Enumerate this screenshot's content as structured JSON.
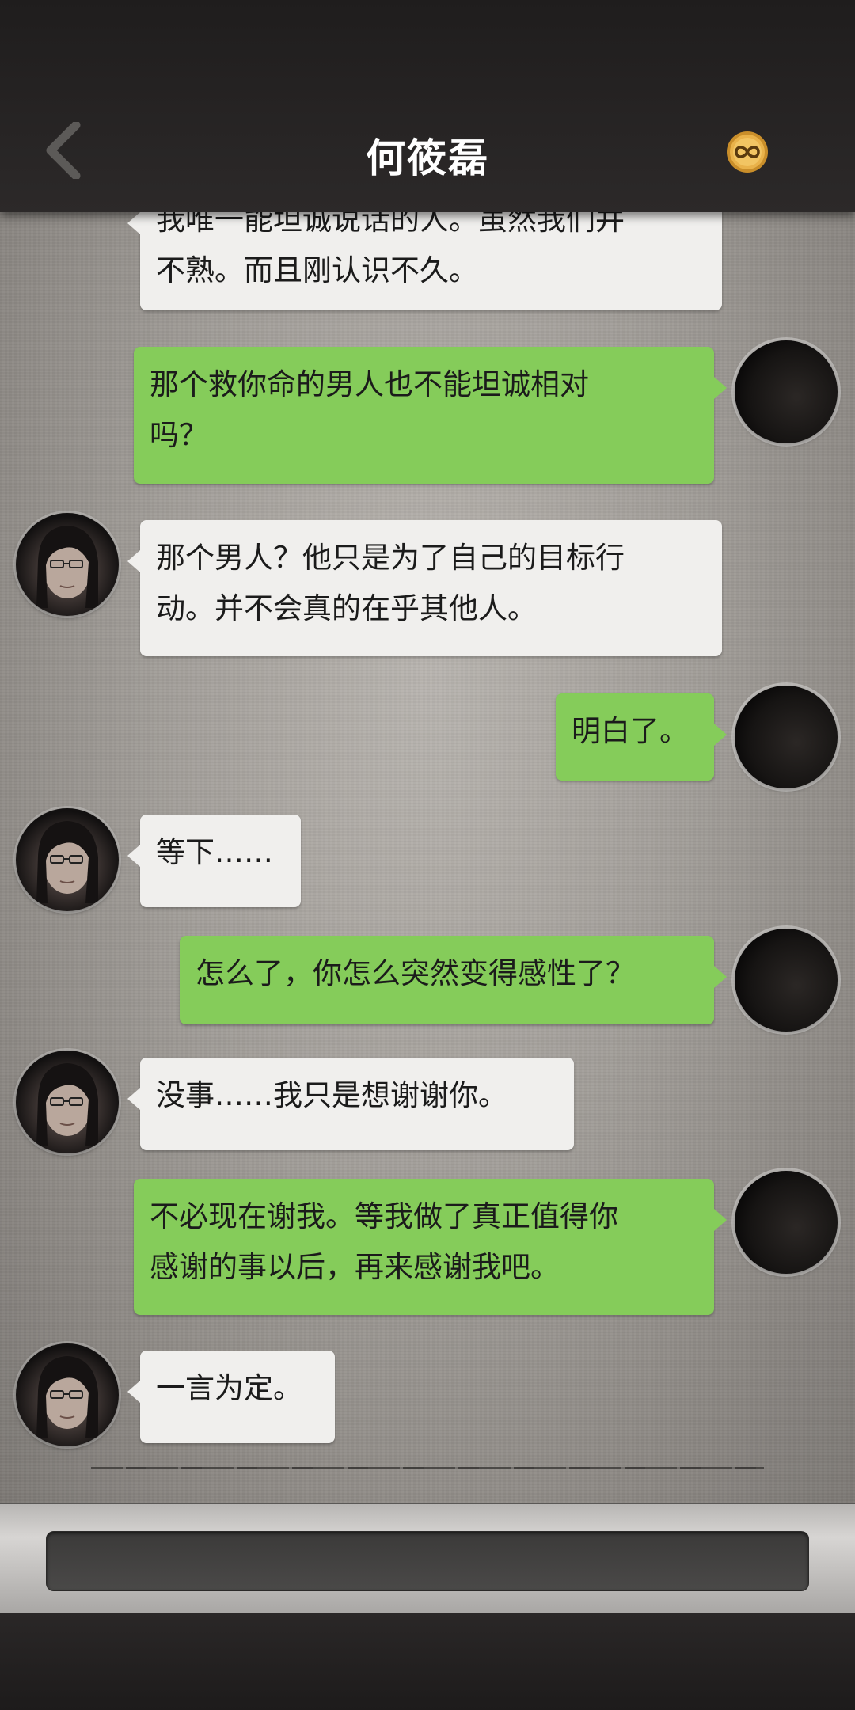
{
  "header": {
    "title": "何筱磊",
    "back_icon": "chevron-left-icon",
    "badge_icon": "infinity-coin-icon"
  },
  "messages": [
    {
      "side": "in",
      "text_line1": "我唯一能坦诚说话的人。虽然我们并",
      "text_line2": "不熟。而且刚认识不久。"
    },
    {
      "side": "out",
      "text_line1": "那个救你命的男人也不能坦诚相对",
      "text_line2": "吗？"
    },
    {
      "side": "in",
      "text_line1": "那个男人？他只是为了自己的目标行",
      "text_line2": "动。并不会真的在乎其他人。"
    },
    {
      "side": "out",
      "text_line1": "明白了。"
    },
    {
      "side": "in",
      "text_line1": "等下……"
    },
    {
      "side": "out",
      "text_line1": "怎么了，你怎么突然变得感性了？"
    },
    {
      "side": "in",
      "text_line1": "没事……我只是想谢谢你。"
    },
    {
      "side": "out",
      "text_line1": "不必现在谢我。等我做了真正值得你",
      "text_line2": "感谢的事以后，再来感谢我吧。"
    },
    {
      "side": "in",
      "text_line1": "一言为定。"
    }
  ],
  "input": {
    "placeholder": ""
  },
  "colors": {
    "incoming_bubble": "#f0efed",
    "outgoing_bubble": "#85cc5a",
    "header_bg": "#231f1f"
  }
}
